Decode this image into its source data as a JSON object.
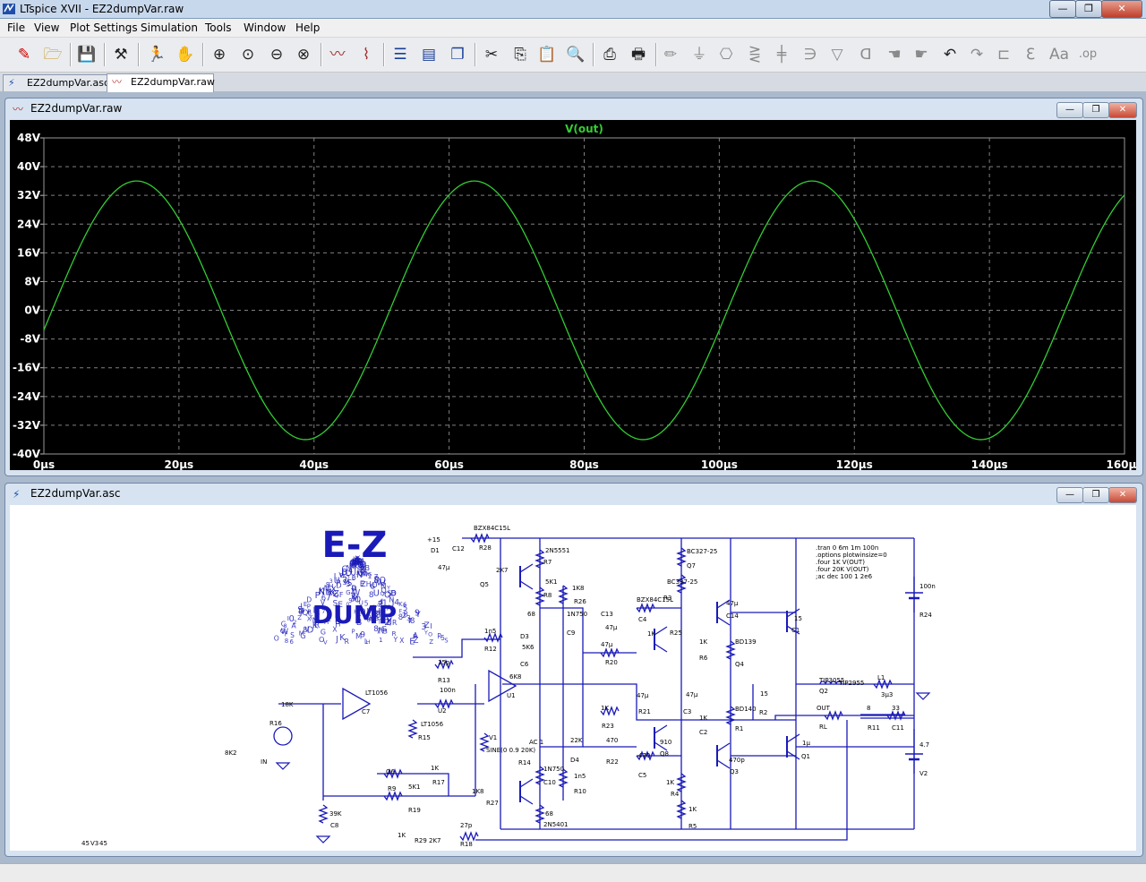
{
  "app": {
    "title": "LTspice XVII - EZ2dumpVar.raw"
  },
  "window_controls": {
    "minimize": "—",
    "maximize": "❐",
    "close": "✕"
  },
  "menu": [
    {
      "label": "File"
    },
    {
      "label": "View"
    },
    {
      "label": "Plot Settings"
    },
    {
      "label": "Simulation"
    },
    {
      "label": "Tools"
    },
    {
      "label": "Window"
    },
    {
      "label": "Help"
    }
  ],
  "tabs": [
    {
      "label": "EZ2dumpVar.asc",
      "active": false
    },
    {
      "label": "EZ2dumpVar.raw",
      "active": true
    }
  ],
  "plot_window": {
    "title": "EZ2dumpVar.raw",
    "trace_color": "#33cc33",
    "grid_color": "#808080"
  },
  "chart_data": {
    "type": "line",
    "title": "",
    "xlabel": "",
    "ylabel": "",
    "xlim": [
      0,
      160
    ],
    "ylim": [
      -40,
      48
    ],
    "x_ticks": [
      "0µs",
      "20µs",
      "40µs",
      "60µs",
      "80µs",
      "100µs",
      "120µs",
      "140µs",
      "160µs"
    ],
    "y_ticks": [
      "48V",
      "40V",
      "32V",
      "24V",
      "16V",
      "8V",
      "0V",
      "-8V",
      "-16V",
      "-24V",
      "-32V",
      "-40V"
    ],
    "grid": true,
    "series": [
      {
        "name": "V(out)",
        "color": "#33cc33",
        "amplitude": 36,
        "offset": 0,
        "frequency_hz": 20000,
        "start_value": -5.5
      }
    ]
  },
  "schematic_window": {
    "title": "EZ2dumpVar.asc",
    "logo": {
      "top": "E-Z",
      "bottom": "DUMP"
    },
    "directives": [
      ".tran 0 6m 1m 100n",
      ".options plotwinsize=0",
      ".four 1K V(OUT)",
      ".four 20K V(OUT)",
      ";ac dec 100 1 2e6"
    ],
    "labels": [
      "+15",
      "D1",
      "C12",
      "47µ",
      "BZX84C15L",
      "R28",
      "2K7",
      "Q5",
      "2N5551",
      "R7",
      "5K1",
      "R8",
      "1K8",
      "R26",
      "68",
      "D3",
      "1N750",
      "C9",
      "1n5",
      "R12",
      "5K6",
      "C6",
      "15p",
      "R13",
      "6K8",
      "U1",
      "LT1056",
      "C7",
      "100n",
      "U2",
      "LT1056",
      "R15",
      "18K",
      "R16",
      "8K2",
      "IN",
      "V1",
      "SINE(0 0.9 20K)",
      "AC 1",
      "R14",
      "22K",
      "D4",
      "1N750",
      "C10",
      "1n5",
      "R10",
      "1K8",
      "R27",
      "68",
      "2N5401",
      "Q6",
      "R9",
      "5K1",
      "R19",
      "1K",
      "R17",
      "39K",
      "C8",
      "27p",
      "R18",
      "1K",
      "R29",
      "2K7",
      "-15",
      "D2",
      "C13",
      "47µ",
      "BZX84C15L",
      "C4",
      "47µ",
      "R20",
      "1K",
      "R23",
      "470",
      "R22",
      "470",
      "C5",
      "47µ",
      "R21",
      "1K",
      "R25",
      "910",
      "Q8",
      "BC327-25",
      "Q7",
      "BC337-25",
      "R3",
      "1K",
      "R4",
      "1K",
      "R5",
      "1K",
      "R6",
      "1K",
      "C2",
      "47µ",
      "C3",
      "47µ",
      "C14",
      "470p",
      "Q3",
      "BD139",
      "Q4",
      "BD140",
      "R1",
      "15",
      "R2",
      "15",
      "C1",
      "1µ",
      "Q1",
      "TIP3055",
      "Q2",
      "TIP2955",
      "L1",
      "3µ3",
      "OUT",
      "RL",
      "8",
      "R11",
      "33",
      "C11",
      "100n",
      "R24",
      "4.7",
      "V2",
      "45",
      "V3",
      "45"
    ]
  }
}
